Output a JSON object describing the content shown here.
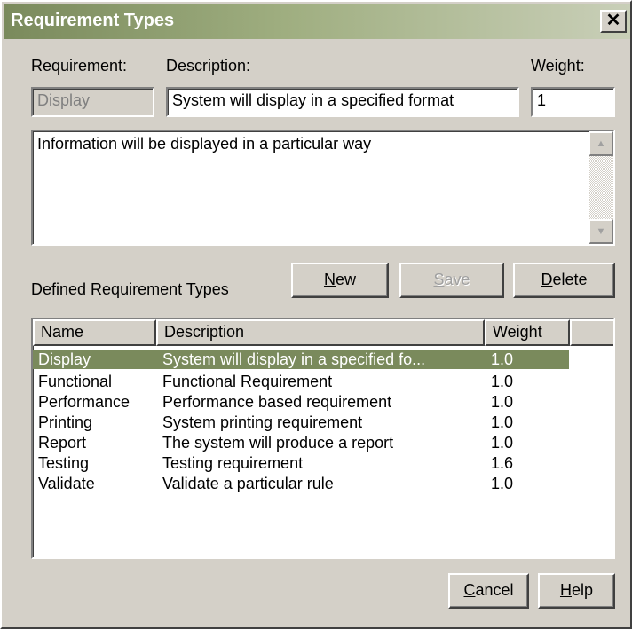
{
  "window": {
    "title": "Requirement Types"
  },
  "labels": {
    "requirement": "Requirement:",
    "description": "Description:",
    "weight": "Weight:",
    "defined": "Defined Requirement Types"
  },
  "fields": {
    "requirement": "Display",
    "description": "System will display in a specified format",
    "weight": "1",
    "notes": "Information will be displayed in a particular way"
  },
  "buttons": {
    "new_ul": "N",
    "new_rest": "ew",
    "save_ul": "S",
    "save_rest": "ave",
    "delete_ul": "D",
    "delete_rest": "elete",
    "cancel_ul": "C",
    "cancel_rest": "ancel",
    "help_ul": "H",
    "help_rest": "elp"
  },
  "table": {
    "columns": [
      "Name",
      "Description",
      "Weight"
    ],
    "rows": [
      {
        "name": "Display",
        "description": "System will display in a specified fo...",
        "weight": "1.0"
      },
      {
        "name": "Functional",
        "description": "Functional Requirement",
        "weight": "1.0"
      },
      {
        "name": "Performance",
        "description": "Performance based requirement",
        "weight": "1.0"
      },
      {
        "name": "Printing",
        "description": "System printing requirement",
        "weight": "1.0"
      },
      {
        "name": "Report",
        "description": "The system will produce a report",
        "weight": "1.0"
      },
      {
        "name": "Testing",
        "description": "Testing requirement",
        "weight": "1.6"
      },
      {
        "name": "Validate",
        "description": "Validate a particular rule",
        "weight": "1.0"
      }
    ],
    "selected_index": 0
  },
  "colors": {
    "selection": "#7a8a5c",
    "face": "#d4d0c8"
  }
}
